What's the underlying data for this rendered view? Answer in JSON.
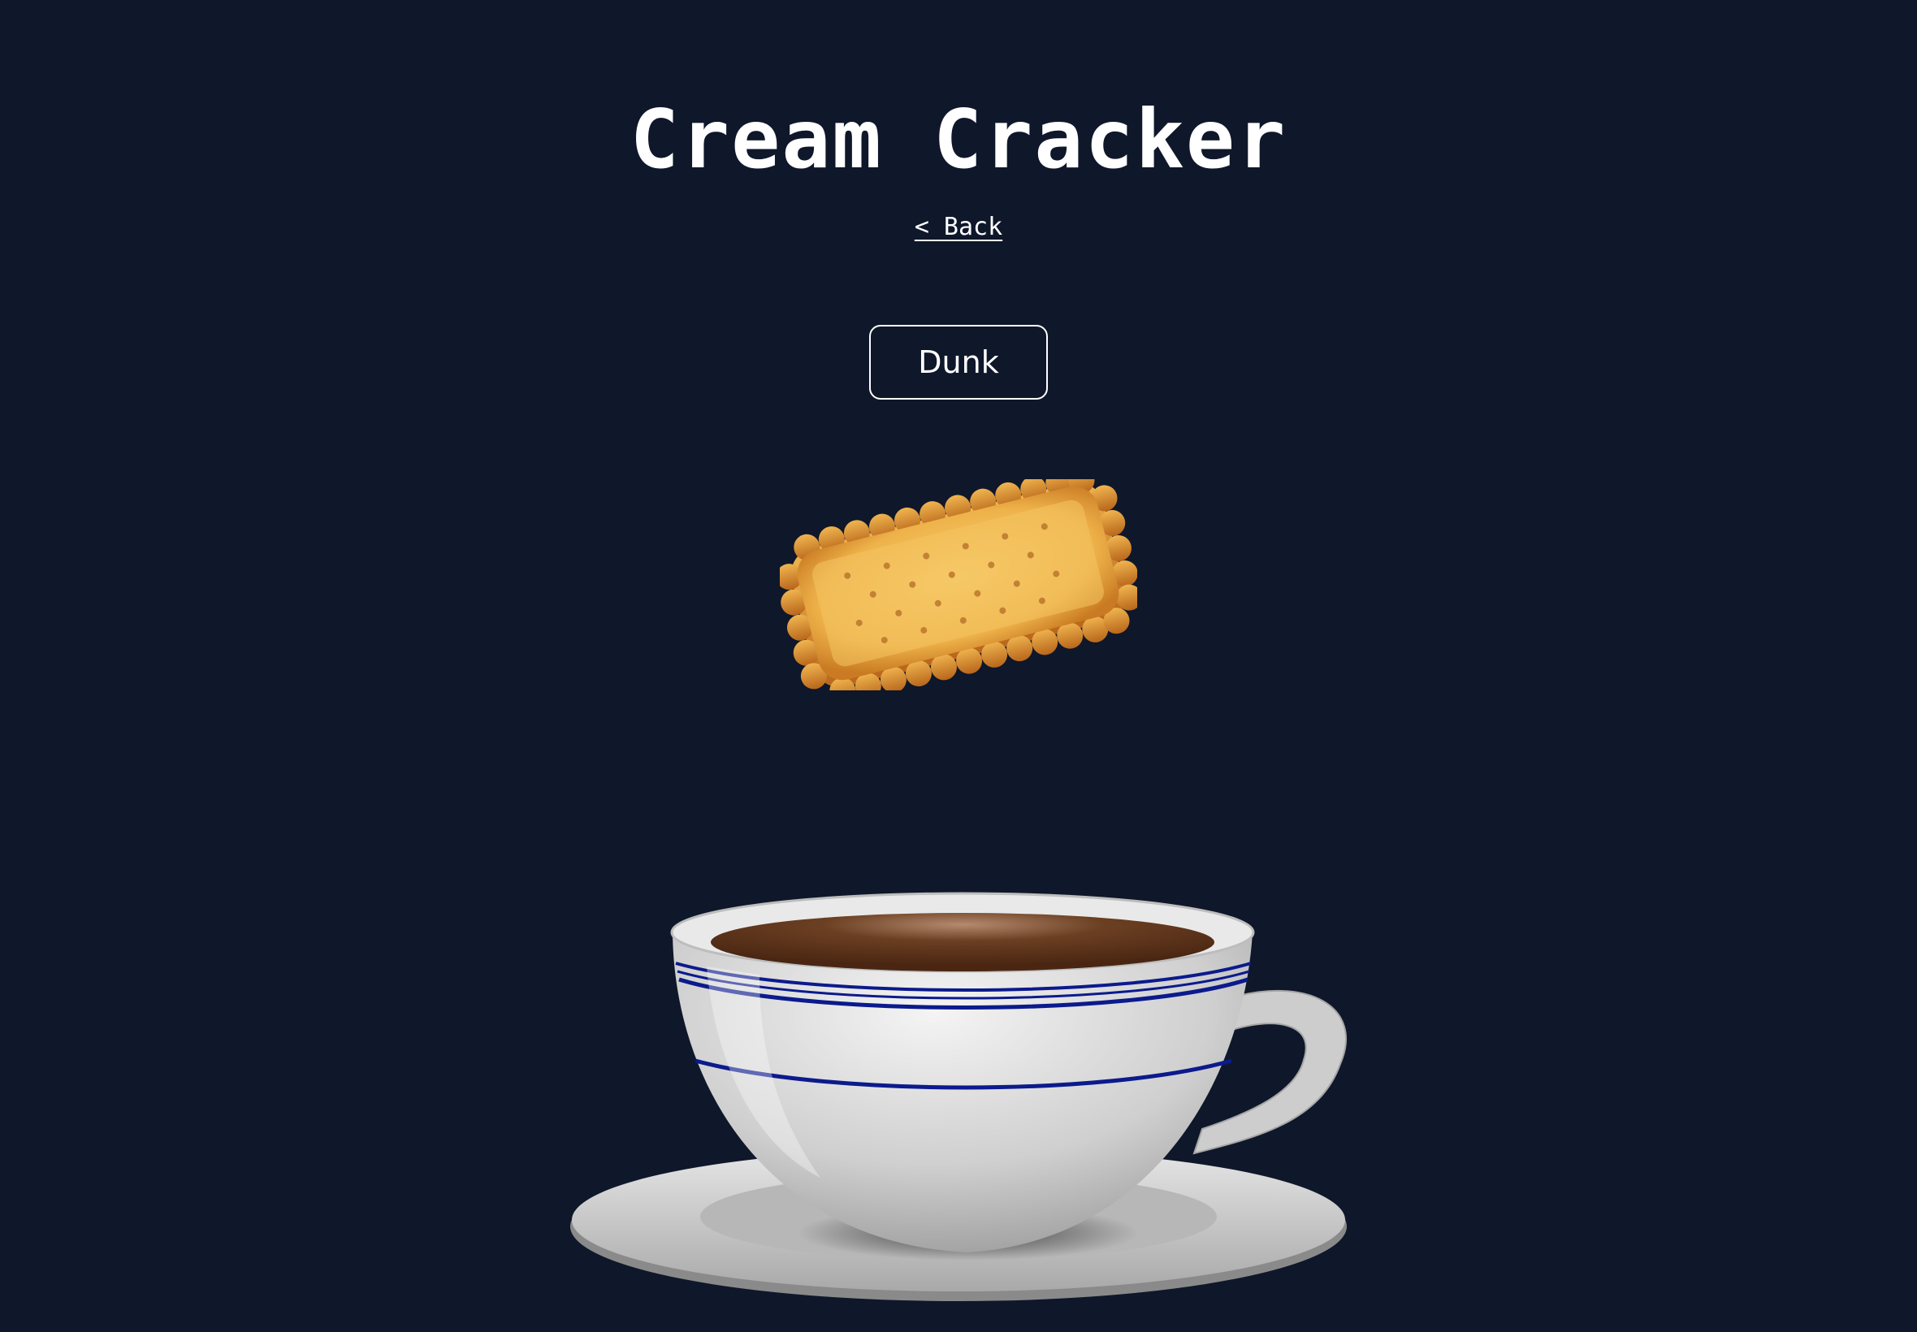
{
  "page": {
    "title": "Cream Cracker",
    "back_link": "< Back",
    "dunk_button": "Dunk"
  },
  "colors": {
    "background": "#0f172a",
    "text": "#ffffff",
    "biscuit": "#f2b94f",
    "cup": "#d9d9d9",
    "cup_stripe": "#0b1a8c",
    "coffee": "#5a3520"
  },
  "illustrations": {
    "biscuit": "biscuit-image",
    "cup": "teacup-with-saucer-image"
  }
}
